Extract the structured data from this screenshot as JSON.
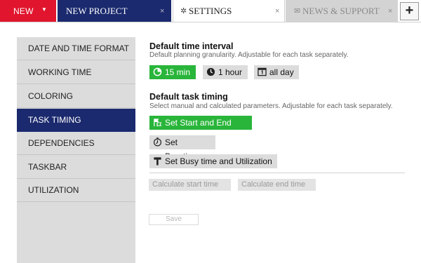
{
  "tabs": {
    "new_label": "NEW",
    "new_caret": "▼",
    "project_label": "NEW PROJECT",
    "settings_label": "SETTINGS",
    "news_label": "NEWS & SUPPORT",
    "close_glyph": "×",
    "add_glyph": "+"
  },
  "sidebar": {
    "items": [
      {
        "label": "DATE AND TIME FORMAT",
        "active": false
      },
      {
        "label": "WORKING TIME",
        "active": false
      },
      {
        "label": "COLORING",
        "active": false
      },
      {
        "label": "TASK TIMING",
        "active": true
      },
      {
        "label": "DEPENDENCIES",
        "active": false
      },
      {
        "label": "TASKBAR",
        "active": false
      },
      {
        "label": "UTILIZATION",
        "active": false
      }
    ]
  },
  "interval": {
    "title": "Default time interval",
    "description": "Default planning granularity. Adjustable for each task separately.",
    "options": [
      {
        "label": "15 min",
        "icon": "pie-clock-icon",
        "selected": true
      },
      {
        "label": "1 hour",
        "icon": "clock-icon",
        "selected": false
      },
      {
        "label": "all day",
        "icon": "calendar-day-icon",
        "selected": false
      }
    ]
  },
  "timing": {
    "title": "Default task timing",
    "description": "Select manual and calculated parameters. Adjustable for each task separately.",
    "options": [
      {
        "label": "Set Start and End time",
        "icon": "flags-icon",
        "selected": true
      },
      {
        "label": "Set Duration",
        "icon": "stopwatch-icon",
        "selected": false
      },
      {
        "label": "Set Busy time and Utilization",
        "icon": "hammer-icon",
        "selected": false
      }
    ],
    "calc_start_label": "Calculate start time",
    "calc_end_label": "Calculate end time"
  },
  "save_label": "Save",
  "colors": {
    "new_tab": "#e1152e",
    "navy": "#1b2a6e",
    "selected_green": "#29b53a",
    "sidebar_bg": "#dcdcdc"
  }
}
